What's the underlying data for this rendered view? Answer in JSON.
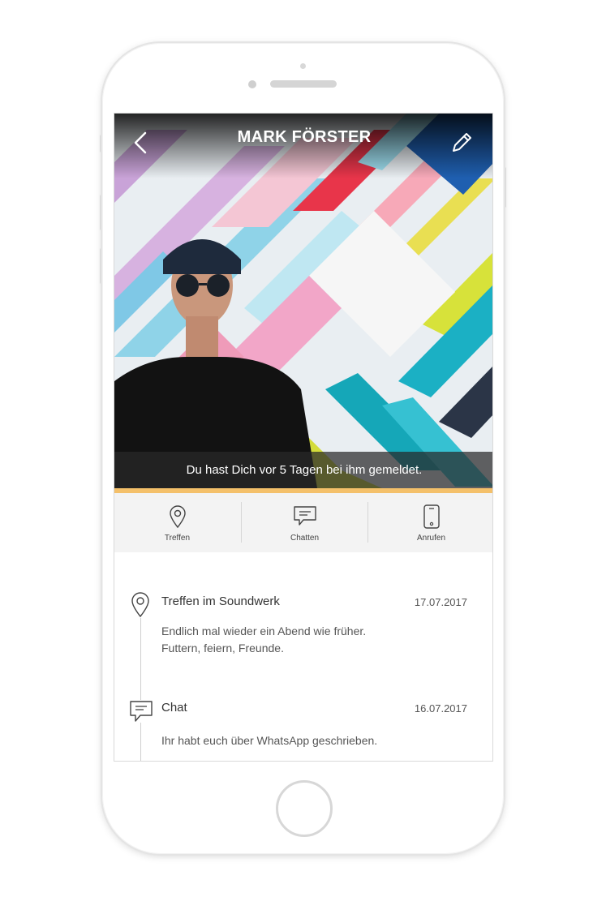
{
  "header": {
    "title": "MARK FÖRSTER",
    "back_icon": "chevron-left-icon",
    "edit_icon": "pencil-icon"
  },
  "hero": {
    "notice": "Du hast Dich vor 5 Tagen bei ihm gemeldet."
  },
  "actions": [
    {
      "label": "Treffen",
      "icon": "location-pin-icon"
    },
    {
      "label": "Chatten",
      "icon": "chat-bubble-icon"
    },
    {
      "label": "Anrufen",
      "icon": "smartphone-icon"
    }
  ],
  "timeline": [
    {
      "icon": "location-pin-icon",
      "title": "Treffen im Soundwerk",
      "date": "17.07.2017",
      "text_lines": [
        "Endlich mal wieder ein Abend wie früher.",
        "Futtern, feiern, Freunde."
      ]
    },
    {
      "icon": "chat-bubble-icon",
      "title": "Chat",
      "date": "16.07.2017",
      "text_lines": [
        "Ihr habt euch über WhatsApp geschrieben."
      ]
    }
  ],
  "colors": {
    "accent": "#f4c06a",
    "action_bar_bg": "#f3f3f3"
  }
}
